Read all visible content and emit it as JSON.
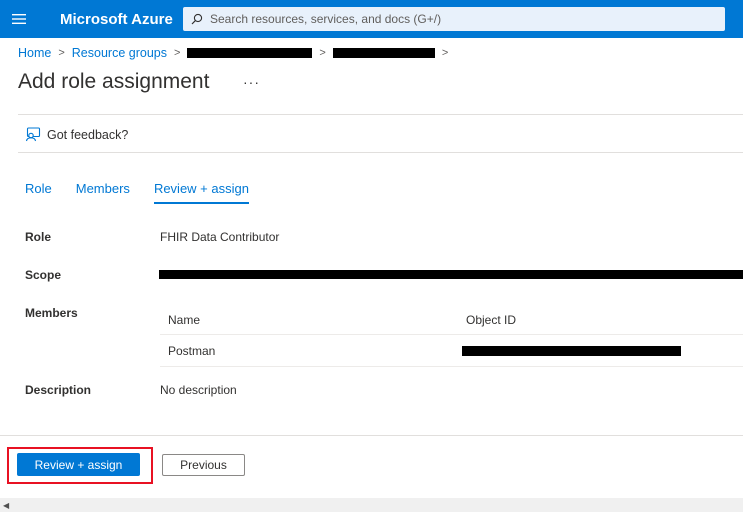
{
  "topbar": {
    "brand": "Microsoft Azure",
    "search_placeholder": "Search resources, services, and docs (G+/)"
  },
  "breadcrumb": {
    "items": [
      "Home",
      "Resource groups"
    ]
  },
  "page": {
    "title": "Add role assignment",
    "more": "···"
  },
  "feedback": {
    "label": "Got feedback?"
  },
  "tabs": [
    {
      "label": "Role",
      "active": false
    },
    {
      "label": "Members",
      "active": false
    },
    {
      "label": "Review + assign",
      "active": true
    }
  ],
  "details": {
    "role_label": "Role",
    "role_value": "FHIR Data Contributor",
    "scope_label": "Scope",
    "members_label": "Members",
    "description_label": "Description",
    "description_value": "No description"
  },
  "members_table": {
    "columns": [
      "Name",
      "Object ID"
    ],
    "rows": [
      {
        "name": "Postman"
      }
    ]
  },
  "footer": {
    "primary_label": "Review + assign",
    "secondary_label": "Previous"
  },
  "colors": {
    "brand_blue": "#0078d4",
    "highlight_red": "#e81123"
  }
}
